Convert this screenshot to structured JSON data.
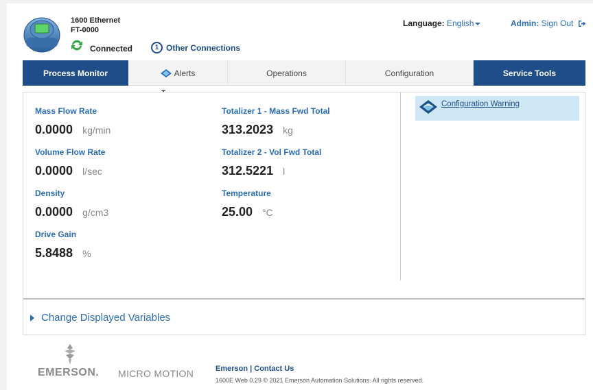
{
  "header": {
    "device_name": "1600 Ethernet",
    "device_tag": "FT-0000",
    "status": "Connected",
    "other_connections_count": "1",
    "other_connections_label": "Other Connections",
    "language_label": "Language:",
    "language_value": "English",
    "admin_label": "Admin:",
    "signout_label": "Sign Out"
  },
  "tabs": [
    {
      "label": "Process Monitor",
      "active": true
    },
    {
      "label": "Alerts",
      "icon": "alert-icon"
    },
    {
      "label": "Operations"
    },
    {
      "label": "Configuration"
    },
    {
      "label": "Service Tools",
      "highlight": true
    }
  ],
  "variables": {
    "mass_flow": {
      "label": "Mass Flow Rate",
      "value": "0.0000",
      "unit": "kg/min"
    },
    "volume_flow": {
      "label": "Volume Flow Rate",
      "value": "0.0000",
      "unit": "l/sec"
    },
    "density": {
      "label": "Density",
      "value": "0.0000",
      "unit": "g/cm3"
    },
    "drive_gain": {
      "label": "Drive Gain",
      "value": "5.8488",
      "unit": "%"
    },
    "totalizer1": {
      "label": "Totalizer 1 - Mass Fwd Total",
      "value": "313.2023",
      "unit": "kg"
    },
    "totalizer2": {
      "label": "Totalizer 2 - Vol Fwd Total",
      "value": "312.5221",
      "unit": "l"
    },
    "temperature": {
      "label": "Temperature",
      "value": "25.00",
      "unit": "°C"
    }
  },
  "alerts_panel": {
    "warning_label": "Configuration Warning"
  },
  "change_vars_label": "Change Displayed Variables",
  "footer": {
    "emerson_brand": "EMERSON.",
    "micromotion_brand": "MICRO MOTION",
    "links": "Emerson | Contact Us",
    "copyright": "1600E Web 0.29   © 2021 Emerson Automation Solutions. All rights reserved."
  },
  "colors": {
    "accent": "#1f4d8a",
    "link": "#2a6db5",
    "warning_bg": "#cfe7f5"
  }
}
